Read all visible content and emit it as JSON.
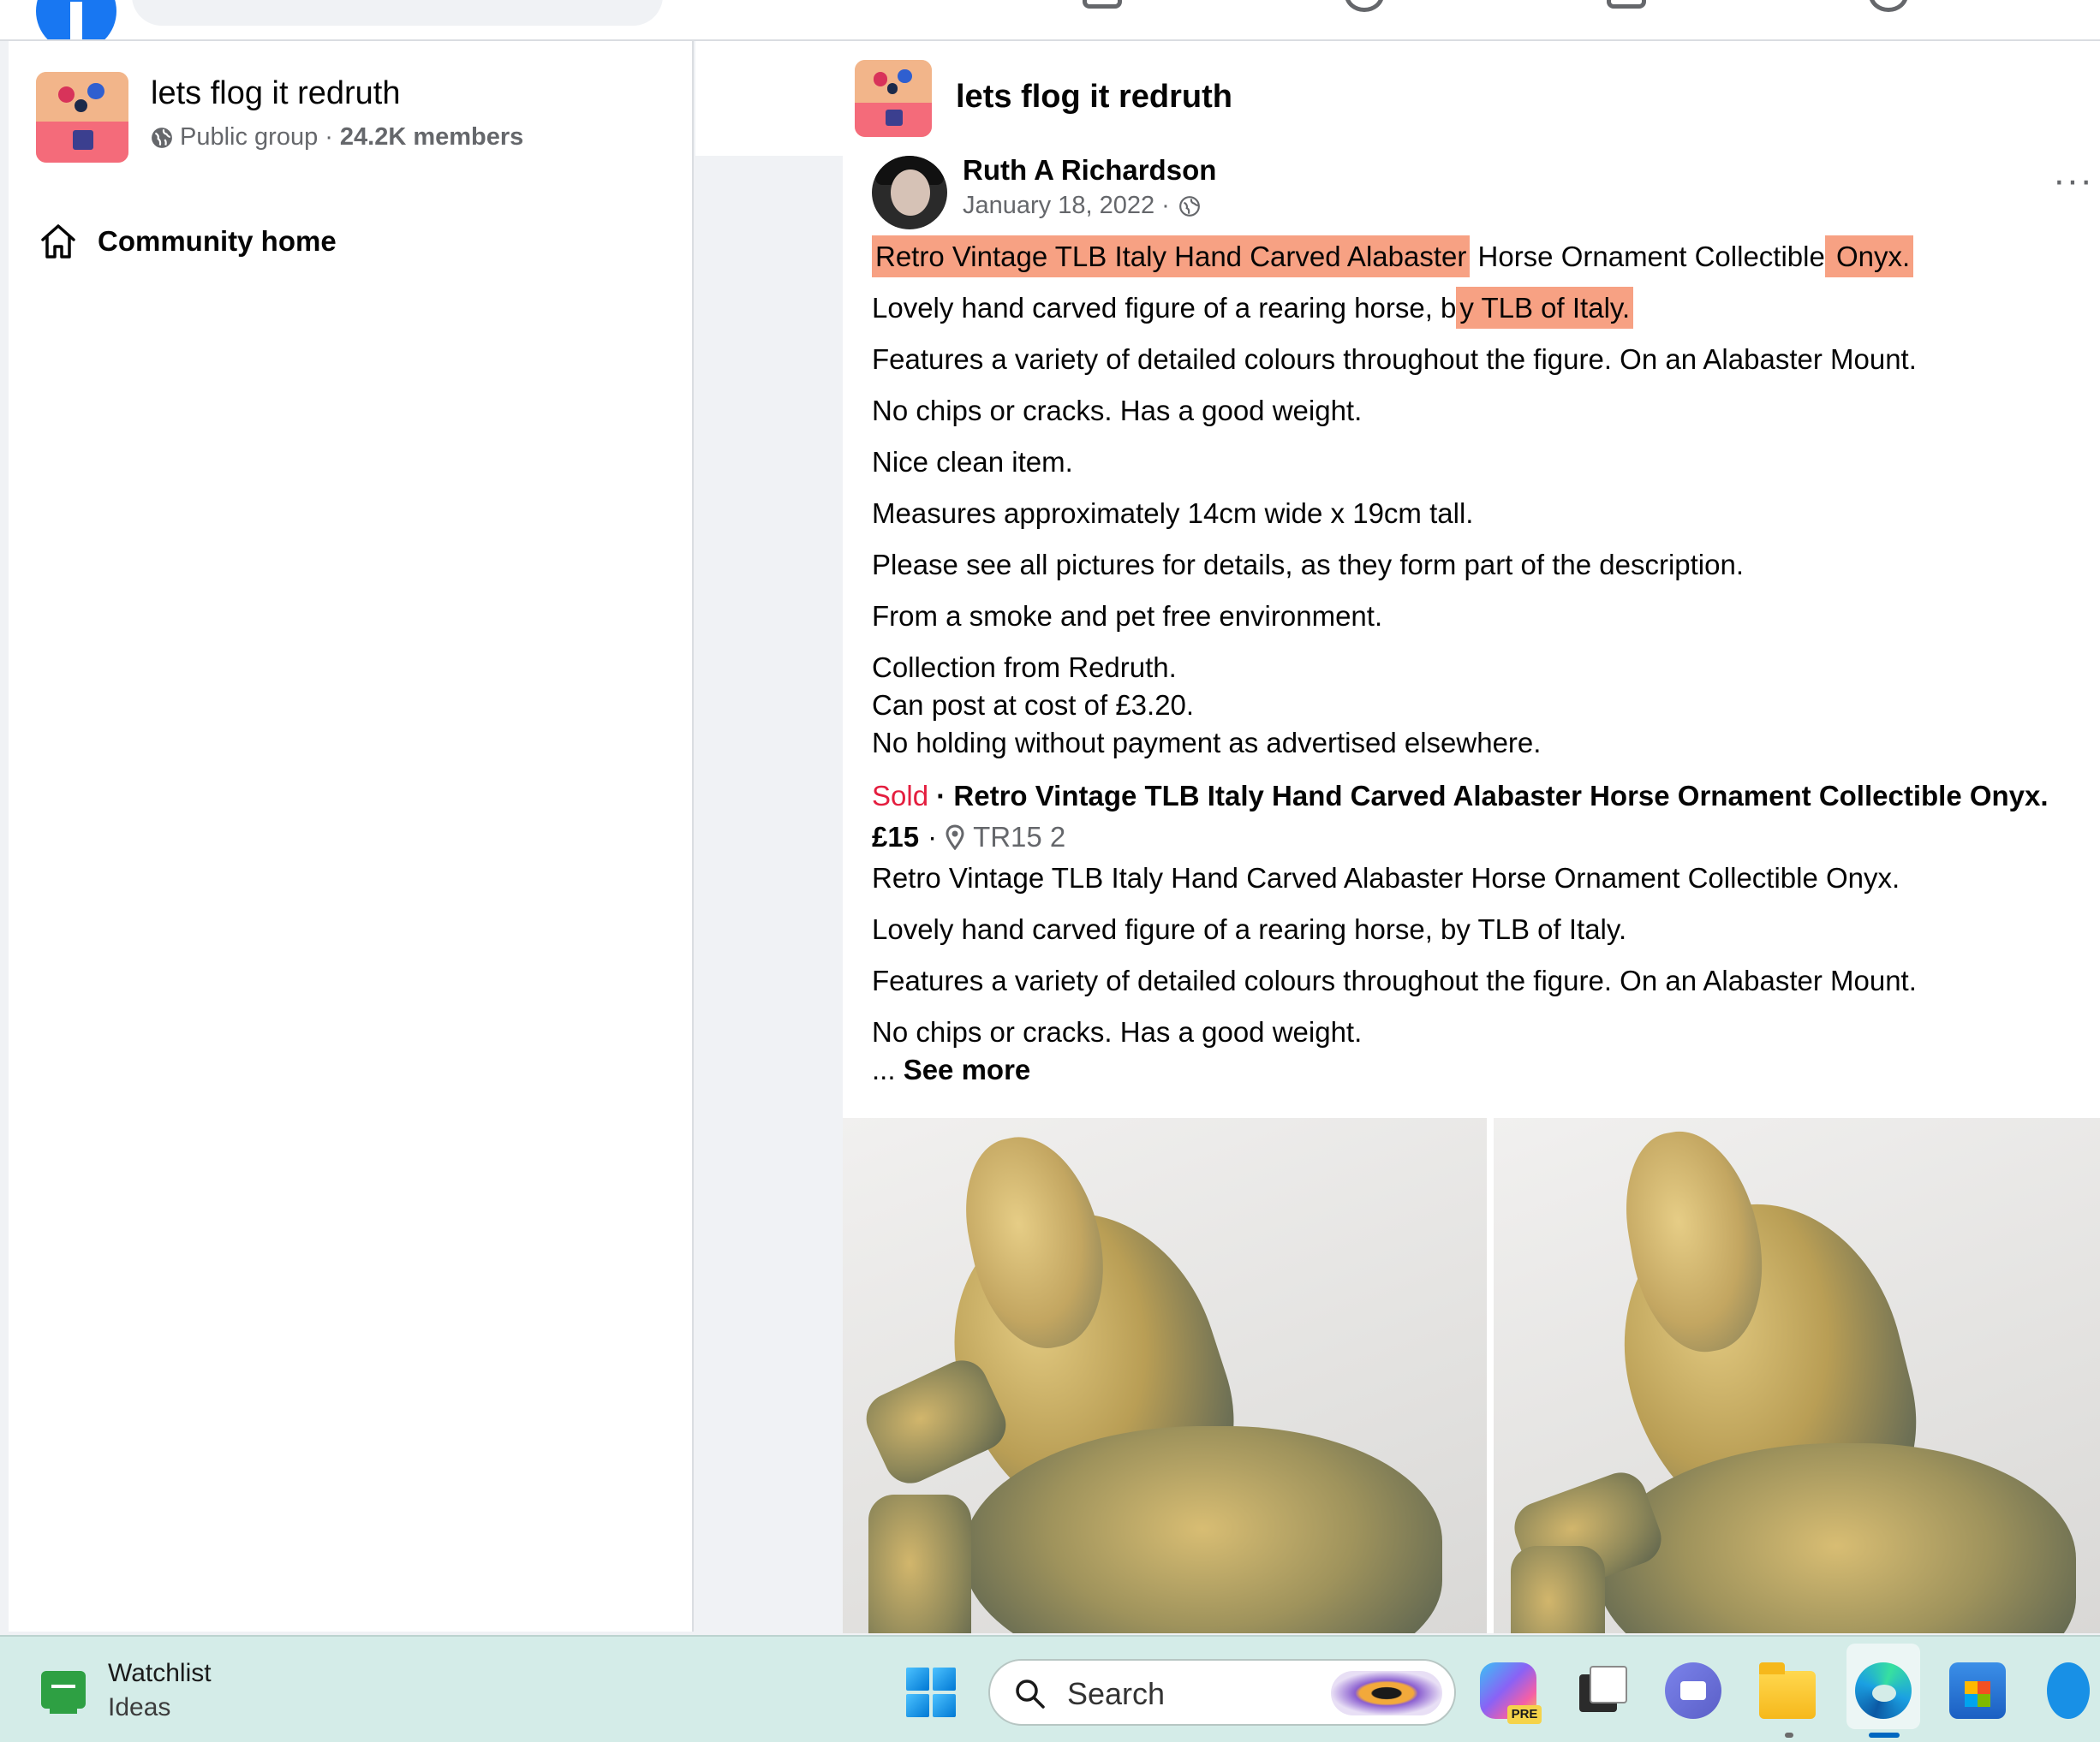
{
  "topbar": {
    "icons": [
      "facebook-logo",
      "search-bar",
      "marketplace-icon",
      "video-icon",
      "groups-icon",
      "profile-icon"
    ]
  },
  "sidebar": {
    "group_name": "lets flog it redruth",
    "privacy": "Public group",
    "separator": "·",
    "members": "24.2K members",
    "nav": [
      {
        "label": "Community home",
        "icon": "home-icon"
      }
    ]
  },
  "main_header": {
    "group_name": "lets flog it redruth"
  },
  "post": {
    "author": "Ruth A Richardson",
    "date": "January 18, 2022 ·",
    "more": "···",
    "line1_hl1": "Retro Vintage TLB Italy Hand Carved Alabaster",
    "line1_mid": " Horse Ornament Collectible",
    "line1_hl2": " Onyx.",
    "line2_pre": "Lovely hand carved figure of a rearing horse, b",
    "line2_hl": "y TLB of Italy.",
    "lines": [
      "Features a variety of detailed colours throughout the figure. On an Alabaster Mount.",
      "No chips or cracks. Has a good weight.",
      "Nice clean item.",
      "Measures approximately 14cm wide x 19cm tall.",
      "Please see all pictures for details, as they form part of the description.",
      "From a smoke and pet free environment.",
      "Collection from Redruth.",
      "Can post at cost of £3.20.",
      "No holding without payment as advertised elsewhere."
    ],
    "listing": {
      "status": "Sold",
      "separator": " · ",
      "title": "Retro Vintage TLB Italy Hand Carved Alabaster Horse Ornament Collectible Onyx.",
      "price": "£15",
      "dot": "·",
      "location": "TR15 2"
    },
    "description": [
      "Retro Vintage TLB Italy Hand Carved Alabaster Horse Ornament Collectible Onyx.",
      "Lovely hand carved figure of a rearing horse, by TLB of Italy.",
      "Features a variety of detailed colours throughout the figure. On an Alabaster Mount.",
      "No chips or cracks. Has a good weight."
    ],
    "see_more_prefix": "... ",
    "see_more": "See more",
    "highlight_color": "#f4825a"
  },
  "taskbar": {
    "widget_title": "Watchlist",
    "widget_sub": "Ideas",
    "search_label": "Search",
    "copilot_badge": "PRE",
    "apps": [
      "start-icon",
      "search-icon",
      "copilot-icon",
      "task-view-icon",
      "meet-icon",
      "file-explorer-icon",
      "edge-icon",
      "store-icon",
      "app-icon"
    ]
  },
  "colors": {
    "facebook_blue": "#1877f2",
    "sold_red": "#e41e3f",
    "secondary_text": "#65676b",
    "taskbar_bg": "#d4ece8"
  }
}
